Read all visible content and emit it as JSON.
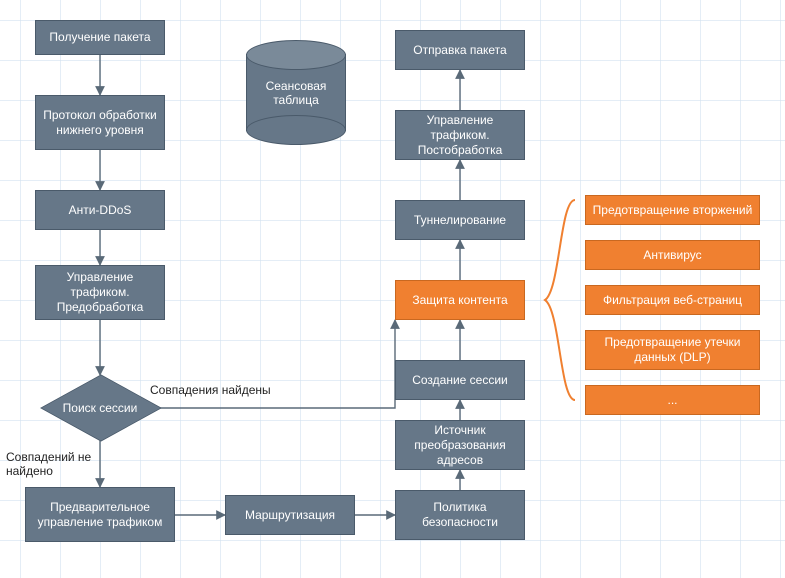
{
  "chart_data": {
    "type": "flowchart",
    "nodes": [
      {
        "id": "n1",
        "label": "Получение пакета",
        "kind": "process",
        "color": "steel"
      },
      {
        "id": "n2",
        "label": "Протокол обработки нижнего уровня",
        "kind": "process",
        "color": "steel"
      },
      {
        "id": "n3",
        "label": "Анти-DDoS",
        "kind": "process",
        "color": "steel"
      },
      {
        "id": "n4",
        "label": "Управление трафиком. Предобработка",
        "kind": "process",
        "color": "steel"
      },
      {
        "id": "d1",
        "label": "Поиск сессии",
        "kind": "decision",
        "color": "steel"
      },
      {
        "id": "n5",
        "label": "Предварительное управление трафиком",
        "kind": "process",
        "color": "steel"
      },
      {
        "id": "n6",
        "label": "Маршрутизация",
        "kind": "process",
        "color": "steel"
      },
      {
        "id": "n7",
        "label": "Политика безопасности",
        "kind": "process",
        "color": "steel"
      },
      {
        "id": "n8",
        "label": "Источник преобразования адресов",
        "kind": "process",
        "color": "steel"
      },
      {
        "id": "n9",
        "label": "Создание сессии",
        "kind": "process",
        "color": "steel"
      },
      {
        "id": "n10",
        "label": "Защита контента",
        "kind": "process",
        "color": "orange"
      },
      {
        "id": "n11",
        "label": "Туннелирование",
        "kind": "process",
        "color": "steel"
      },
      {
        "id": "n12",
        "label": "Управление трафиком. Постобработка",
        "kind": "process",
        "color": "steel"
      },
      {
        "id": "n13",
        "label": "Отправка пакета",
        "kind": "process",
        "color": "steel"
      },
      {
        "id": "db",
        "label": "Сеансовая таблица",
        "kind": "datastore",
        "color": "steel"
      },
      {
        "id": "g1",
        "label": "Предотвращение вторжений",
        "kind": "group-item",
        "color": "orange"
      },
      {
        "id": "g2",
        "label": "Антивирус",
        "kind": "group-item",
        "color": "orange"
      },
      {
        "id": "g3",
        "label": "Фильтрация веб-страниц",
        "kind": "group-item",
        "color": "orange"
      },
      {
        "id": "g4",
        "label": "Предотвращение утечки данных (DLP)",
        "kind": "group-item",
        "color": "orange"
      },
      {
        "id": "g5",
        "label": "...",
        "kind": "group-item",
        "color": "orange"
      }
    ],
    "edges": [
      {
        "from": "n1",
        "to": "n2"
      },
      {
        "from": "n2",
        "to": "n3"
      },
      {
        "from": "n3",
        "to": "n4"
      },
      {
        "from": "n4",
        "to": "d1"
      },
      {
        "from": "d1",
        "to": "n5",
        "label": "Совпадений не найдено"
      },
      {
        "from": "d1",
        "to": "n10",
        "label": "Совпадения найдены"
      },
      {
        "from": "n5",
        "to": "n6"
      },
      {
        "from": "n6",
        "to": "n7"
      },
      {
        "from": "n7",
        "to": "n8"
      },
      {
        "from": "n8",
        "to": "n9"
      },
      {
        "from": "n9",
        "to": "n10"
      },
      {
        "from": "n10",
        "to": "n11"
      },
      {
        "from": "n11",
        "to": "n12"
      },
      {
        "from": "n12",
        "to": "n13"
      }
    ],
    "group": {
      "of": "n10",
      "items": [
        "g1",
        "g2",
        "g3",
        "g4",
        "g5"
      ]
    },
    "colors": {
      "steel": "#667788",
      "orange": "#f08030"
    }
  },
  "edge_labels": {
    "match_found": "Совпадения найдены",
    "no_match": "Совпадений не найдено"
  }
}
